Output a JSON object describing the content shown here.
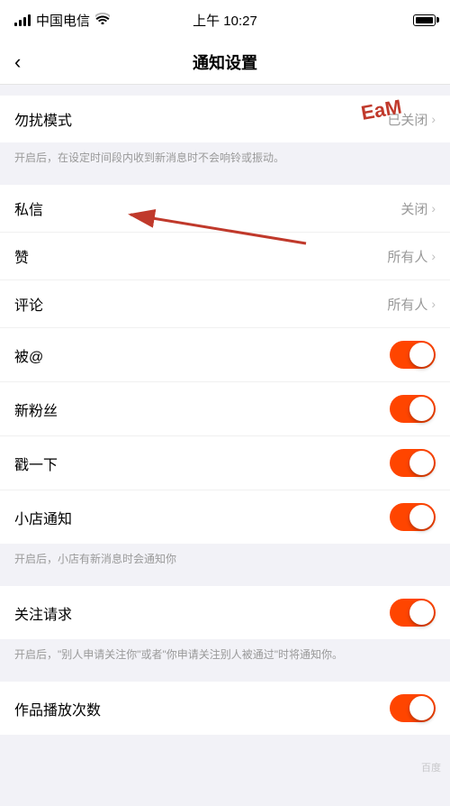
{
  "statusBar": {
    "carrier": "中国电信",
    "time": "上午 10:27",
    "battery": "full"
  },
  "navBar": {
    "backLabel": "‹",
    "title": "通知设置"
  },
  "sections": [
    {
      "id": "dnd",
      "items": [
        {
          "label": "勿扰模式",
          "valueText": "已关闭",
          "type": "link"
        }
      ],
      "description": "开启后，在设定时间段内收到新消息时不会响铃或振动。"
    },
    {
      "id": "messages",
      "items": [
        {
          "label": "私信",
          "valueText": "关闭",
          "type": "link"
        },
        {
          "label": "赞",
          "valueText": "所有人",
          "type": "link"
        },
        {
          "label": "评论",
          "valueText": "所有人",
          "type": "link"
        },
        {
          "label": "被@",
          "valueText": "",
          "type": "toggle",
          "on": true
        },
        {
          "label": "新粉丝",
          "valueText": "",
          "type": "toggle",
          "on": true
        },
        {
          "label": "戳一下",
          "valueText": "",
          "type": "toggle",
          "on": true
        },
        {
          "label": "小店通知",
          "valueText": "",
          "type": "toggle",
          "on": true
        }
      ],
      "description": "开启后，小店有新消息时会通知你"
    },
    {
      "id": "follow",
      "items": [
        {
          "label": "关注请求",
          "valueText": "",
          "type": "toggle",
          "on": true
        }
      ],
      "description": "开启后，\"别人申请关注你\"或者\"你申请关注别人被通过\"时将通知你。"
    },
    {
      "id": "playcount",
      "items": [
        {
          "label": "作品播放次数",
          "valueText": "",
          "type": "toggle",
          "on": false,
          "partial": true
        }
      ]
    }
  ],
  "arrow": {
    "label": "EaM"
  }
}
